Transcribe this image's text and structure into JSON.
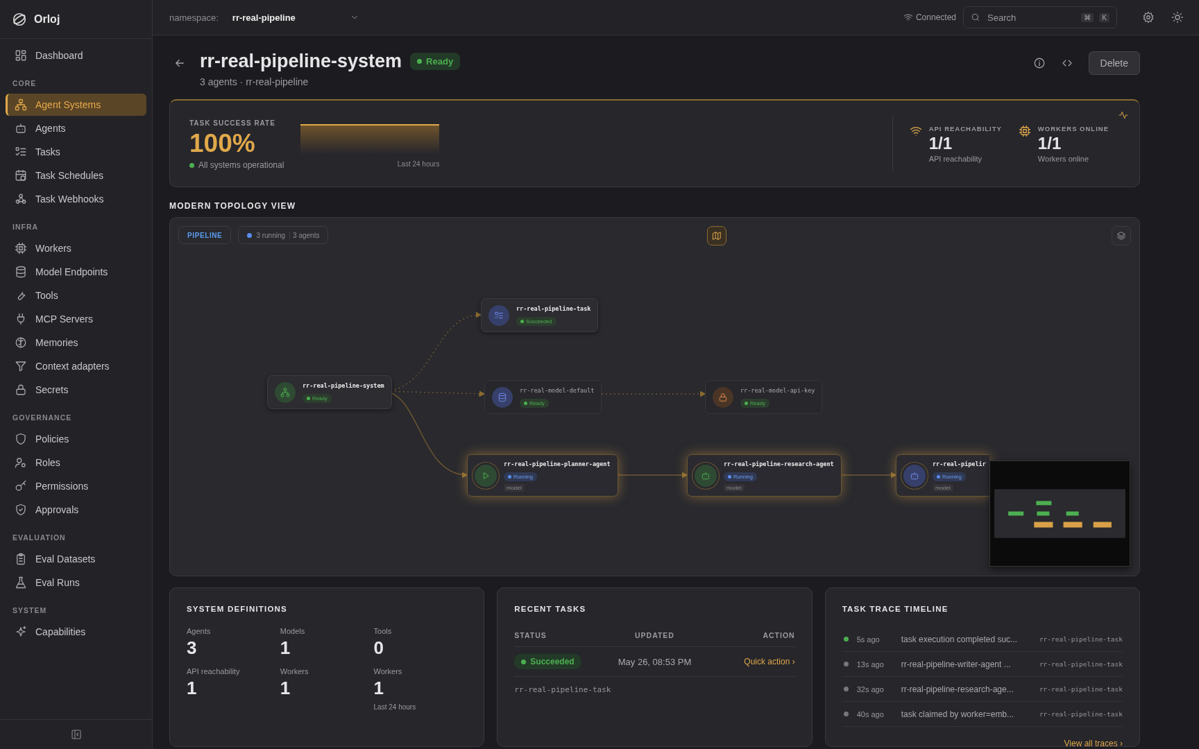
{
  "sidebar": {
    "brand": "Orloj",
    "top_items": [
      {
        "label": "Dashboard",
        "selected": false
      }
    ],
    "sections": [
      {
        "title": "CORE",
        "items": [
          {
            "label": "Agent Systems",
            "selected": true
          },
          {
            "label": "Agents",
            "selected": false
          },
          {
            "label": "Tasks",
            "selected": false
          },
          {
            "label": "Task Schedules",
            "selected": false
          },
          {
            "label": "Task Webhooks",
            "selected": false
          }
        ]
      },
      {
        "title": "INFRA",
        "items": [
          {
            "label": "Workers",
            "selected": false
          },
          {
            "label": "Model Endpoints",
            "selected": false
          },
          {
            "label": "Tools",
            "selected": false
          },
          {
            "label": "MCP Servers",
            "selected": false
          },
          {
            "label": "Memories",
            "selected": false
          },
          {
            "label": "Context adapters",
            "selected": false
          },
          {
            "label": "Secrets",
            "selected": false
          }
        ]
      },
      {
        "title": "GOVERNANCE",
        "items": [
          {
            "label": "Policies",
            "selected": false
          },
          {
            "label": "Roles",
            "selected": false
          },
          {
            "label": "Permissions",
            "selected": false
          },
          {
            "label": "Approvals",
            "selected": false
          }
        ]
      },
      {
        "title": "EVALUATION",
        "items": [
          {
            "label": "Eval Datasets",
            "selected": false
          },
          {
            "label": "Eval Runs",
            "selected": false
          }
        ]
      },
      {
        "title": "SYSTEM",
        "items": [
          {
            "label": "Capabilities",
            "selected": false
          }
        ]
      }
    ]
  },
  "topbar": {
    "namespace_label": "namespace:",
    "namespace": "rr-real-pipeline",
    "connection": "Connected",
    "search": {
      "placeholder": "Search"
    },
    "shortcut": [
      "⌘",
      "K"
    ]
  },
  "header": {
    "title": "rr-real-pipeline-system",
    "status": "Ready",
    "subtitle": "3 agents · rr-real-pipeline",
    "delete": "Delete"
  },
  "health": {
    "label": "TASK SUCCESS RATE",
    "value": "100%",
    "note": "All systems operational",
    "range": "Last 24 hours",
    "metrics": [
      {
        "kind": "wifi",
        "label": "API REACHABILITY",
        "value": "1/1",
        "caption": "API reachability"
      },
      {
        "kind": "chip",
        "label": "WORKERS ONLINE",
        "value": "1/1",
        "caption": "Workers online"
      }
    ]
  },
  "topology": {
    "title": "MODERN TOPOLOGY VIEW",
    "mode": "PIPELINE",
    "running": "3 running",
    "agents": "3 agents",
    "nodes": [
      {
        "kind": "system",
        "name": "rr-real-pipeline-system",
        "status": "Ready",
        "color": "#4caf50"
      },
      {
        "kind": "task",
        "name": "rr-real-pipeline-task",
        "status": "Succeeded",
        "color": "#4caf50"
      },
      {
        "kind": "model",
        "name": "rr-real-model-default",
        "status": "Ready",
        "color": "#4caf50"
      },
      {
        "kind": "secret",
        "name": "rr-real-model-api-key",
        "status": "Ready",
        "color": "#4caf50"
      },
      {
        "kind": "planner",
        "name": "rr-real-pipeline-planner-agent",
        "status": "Running",
        "color": "#5b8def",
        "tag": "model"
      },
      {
        "kind": "agent",
        "name": "rr-real-pipeline-research-agent",
        "status": "Running",
        "color": "#5b8def",
        "tag": "model"
      },
      {
        "kind": "agent",
        "name": "rr-real-pipelir",
        "status": "Running",
        "color": "#5b8def",
        "tag": "model"
      }
    ]
  },
  "definitions": {
    "title": "SYSTEM DEFINITIONS",
    "items": [
      {
        "label": "Agents",
        "value": "3"
      },
      {
        "label": "Models",
        "value": "1"
      },
      {
        "label": "Tools",
        "value": "0"
      },
      {
        "label": "API reachability",
        "value": "1"
      },
      {
        "label": "Workers",
        "value": "1"
      },
      {
        "label": "Workers",
        "value": "1",
        "note": "Last 24 hours"
      }
    ]
  },
  "recent_tasks": {
    "title": "RECENT TASKS",
    "columns": [
      "STATUS",
      "UPDATED",
      "ACTION"
    ],
    "rows": [
      {
        "status": "Succeeded",
        "updated": "May 26, 08:53 PM",
        "action": "Quick action ›"
      }
    ],
    "task": "rr-real-pipeline-task"
  },
  "timeline": {
    "title": "TASK TRACE TIMELINE",
    "items": [
      {
        "time": "5s ago",
        "text": "task execution completed suc...",
        "task": "rr-real-pipeline-task",
        "color": "#4caf50"
      },
      {
        "time": "13s ago",
        "text": "rr-real-pipeline-writer-agent ...",
        "task": "rr-real-pipeline-task",
        "color": "#77777d"
      },
      {
        "time": "32s ago",
        "text": "rr-real-pipeline-research-age...",
        "task": "rr-real-pipeline-task",
        "color": "#77777d"
      },
      {
        "time": "40s ago",
        "text": "task claimed by worker=emb...",
        "task": "rr-real-pipeline-task",
        "color": "#77777d"
      }
    ],
    "link": "View all traces ›"
  }
}
